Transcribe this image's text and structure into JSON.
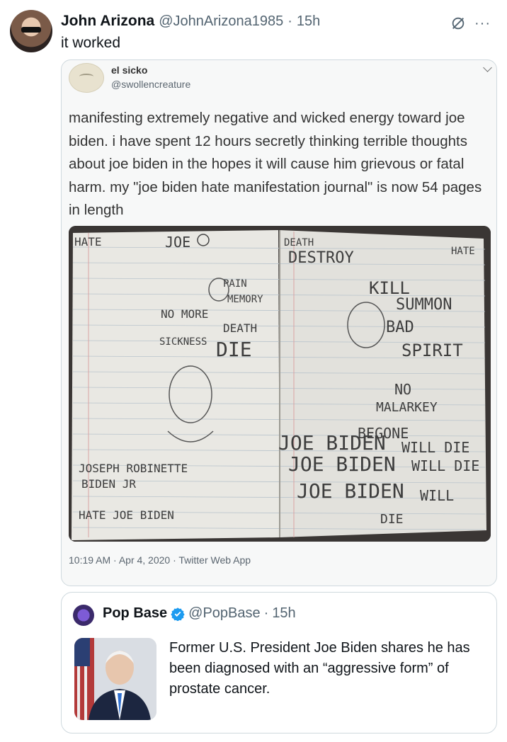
{
  "post": {
    "display_name": "John Arizona",
    "handle": "@JohnArizona1985",
    "separator": "·",
    "time": "15h",
    "text": "it worked",
    "more_icon": "more-icon",
    "grok_icon": "grok-icon"
  },
  "embedded": {
    "name": "el sicko",
    "handle": "@swollencreature",
    "text": "manifesting extremely negative and wicked energy toward joe biden. i have spent 12 hours secretly thinking terrible thoughts about joe biden in the hopes it will cause him grievous or fatal harm. my \"joe biden hate manifestation journal\" is now 54 pages in length",
    "meta": "10:19 AM · Apr 4, 2020 · Twitter Web App",
    "journal_words": {
      "left": [
        "HATE",
        "JOE",
        "NO MORE",
        "PAIN",
        "MEMORY",
        "DEATH",
        "SICKNESS",
        "DIE",
        "JOSEPH ROBINETTE",
        "BIDEN JR",
        "HATE JOE BIDEN"
      ],
      "right": [
        "DEATH",
        "DESTROY",
        "KILL",
        "SUMMON",
        "BAD",
        "SPIRIT",
        "NO",
        "MALARKEY",
        "BEGONE",
        "JOE BIDEN",
        "WILL DIE",
        "JOE BIDEN",
        "WILL DIE",
        "JOE BIDEN",
        "WILL",
        "DIE",
        "HATE"
      ]
    }
  },
  "quote": {
    "name": "Pop Base",
    "handle": "@PopBase",
    "separator": "·",
    "time": "15h",
    "text": "Former U.S. President Joe Biden shares he has been diagnosed with an “aggressive form” of prostate cancer.",
    "verified_icon": "verified-badge-icon"
  }
}
